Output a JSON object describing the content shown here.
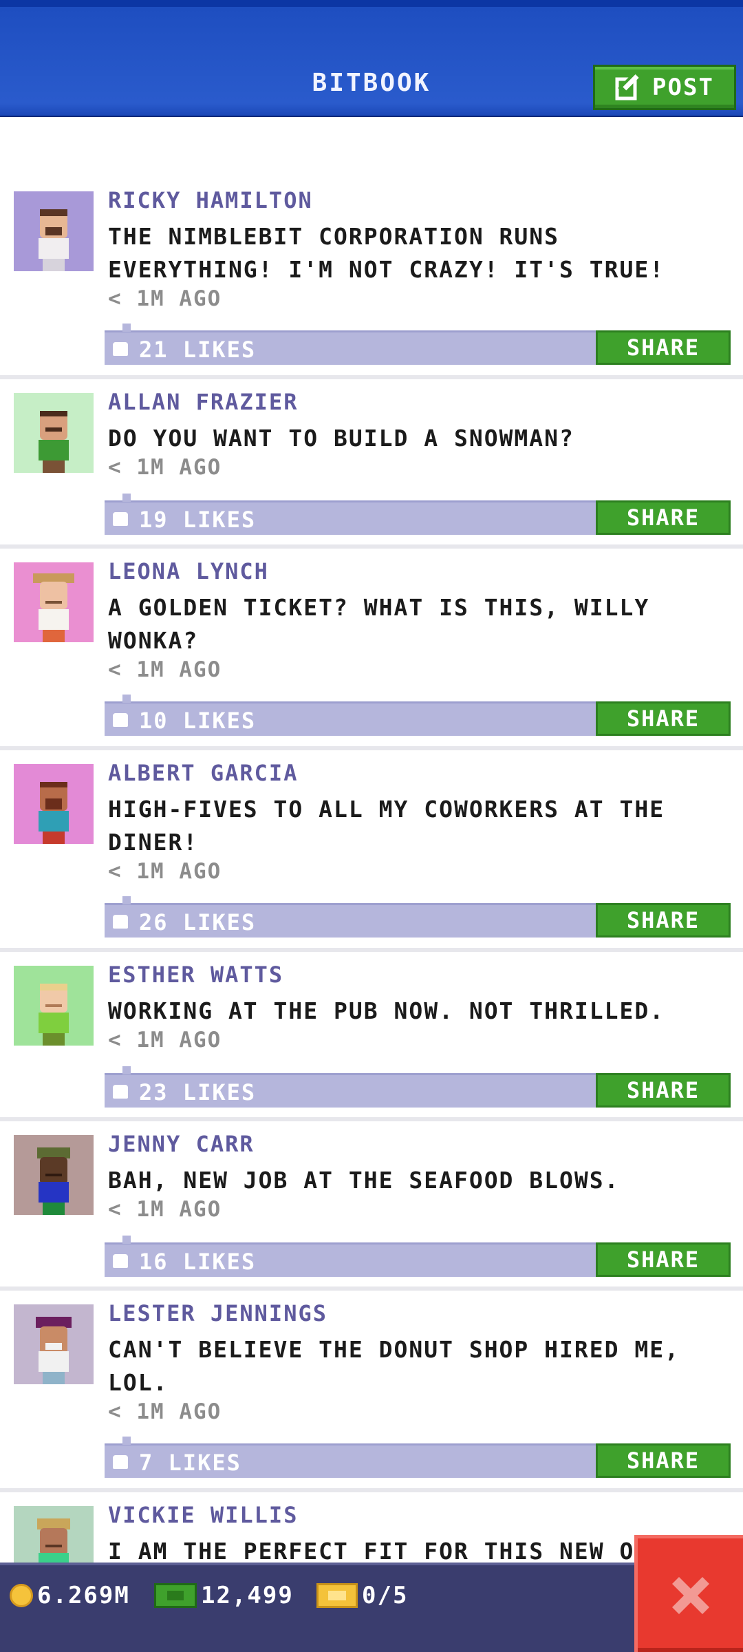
{
  "header": {
    "title": "BITBOOK",
    "post_label": "POST"
  },
  "posts": [
    {
      "name": "RICKY HAMILTON",
      "lines": [
        "THE NIMBLEBIT CORPORATION RUNS",
        "EVERYTHING! I'M NOT CRAZY! IT'S TRUE!"
      ],
      "time": "< 1M AGO",
      "likes": "21 LIKES",
      "share": "SHARE",
      "avatar_bg": "#a899d8"
    },
    {
      "name": "ALLAN FRAZIER",
      "lines": [
        "DO YOU WANT TO BUILD A SNOWMAN?"
      ],
      "time": "< 1M AGO",
      "likes": "19 LIKES",
      "share": "SHARE",
      "avatar_bg": "#c6eec6"
    },
    {
      "name": "LEONA LYNCH",
      "lines": [
        "A GOLDEN TICKET? WHAT IS THIS, WILLY",
        "WONKA?"
      ],
      "time": "< 1M AGO",
      "likes": "10 LIKES",
      "share": "SHARE",
      "avatar_bg": "#ea8fd1"
    },
    {
      "name": "ALBERT GARCIA",
      "lines": [
        "HIGH-FIVES TO ALL MY COWORKERS AT THE",
        "DINER!"
      ],
      "time": "< 1M AGO",
      "likes": "26 LIKES",
      "share": "SHARE",
      "avatar_bg": "#e38ad6"
    },
    {
      "name": "ESTHER WATTS",
      "lines": [
        "WORKING AT THE PUB NOW. NOT THRILLED."
      ],
      "time": "< 1M AGO",
      "likes": "23 LIKES",
      "share": "SHARE",
      "avatar_bg": "#9fe39a"
    },
    {
      "name": "JENNY CARR",
      "lines": [
        "BAH, NEW JOB AT THE SEAFOOD BLOWS."
      ],
      "time": "< 1M AGO",
      "likes": "16 LIKES",
      "share": "SHARE",
      "avatar_bg": "#b59a98"
    },
    {
      "name": "LESTER JENNINGS",
      "lines": [
        "CAN'T BELIEVE THE DONUT SHOP HIRED ME,",
        "LOL."
      ],
      "time": "< 1M AGO",
      "likes": "7 LIKES",
      "share": "SHARE",
      "avatar_bg": "#c3b6cf"
    },
    {
      "name": "VICKIE WILLIS",
      "lines": [
        "I AM THE PERFECT FIT FOR THIS NEW OF"
      ],
      "avatar_bg": "#b4d6bf"
    }
  ],
  "status": {
    "coins": "6.269M",
    "bux": "12,499",
    "tickets": "0/5"
  },
  "icons": {
    "post": "edit-icon",
    "like": "thumbs-up-icon",
    "coin": "coin-icon",
    "bux": "bux-icon",
    "ticket": "golden-ticket-icon",
    "close": "close-icon"
  },
  "colors": {
    "header": "#2a5bcc",
    "share": "#3fa12c",
    "likes_bar": "#b5b6dc",
    "name": "#5f5a9e",
    "close": "#e8392f",
    "bottom_bar": "#3a3d6e"
  }
}
